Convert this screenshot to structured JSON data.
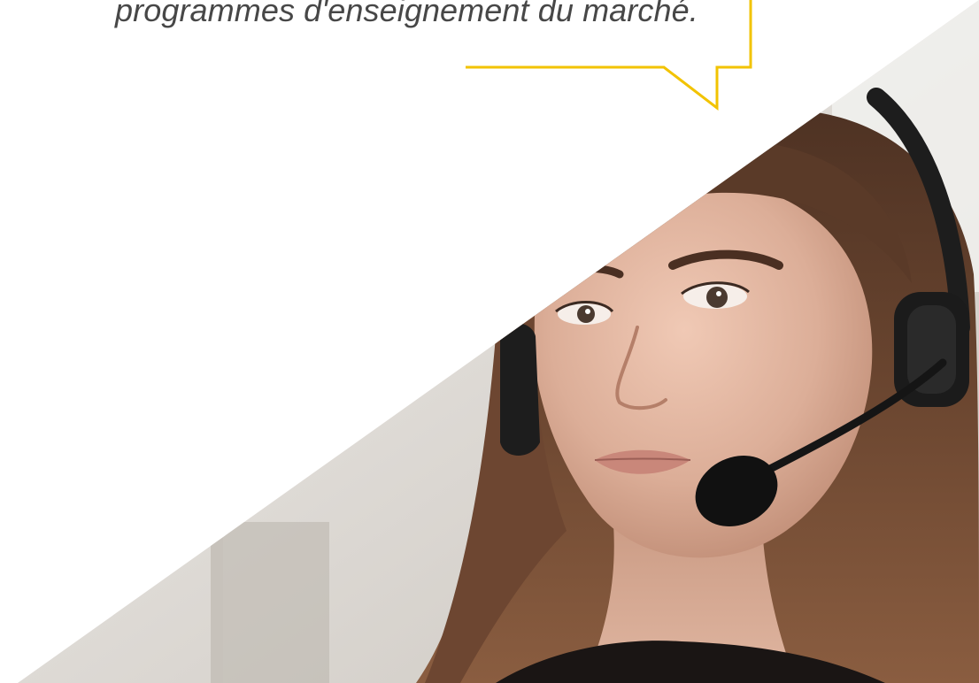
{
  "quote": {
    "text": "programmes d'enseignement du marché."
  },
  "colors": {
    "bubble_border": "#f2c300",
    "quote_text": "#474747",
    "background": "#ffffff",
    "photo_wall": "#d9d6d2",
    "hair": "#6b4630",
    "skin": "#dcae98",
    "headset": "#1d1d1d"
  },
  "photo": {
    "subject": "customer-support-agent-with-headset"
  }
}
